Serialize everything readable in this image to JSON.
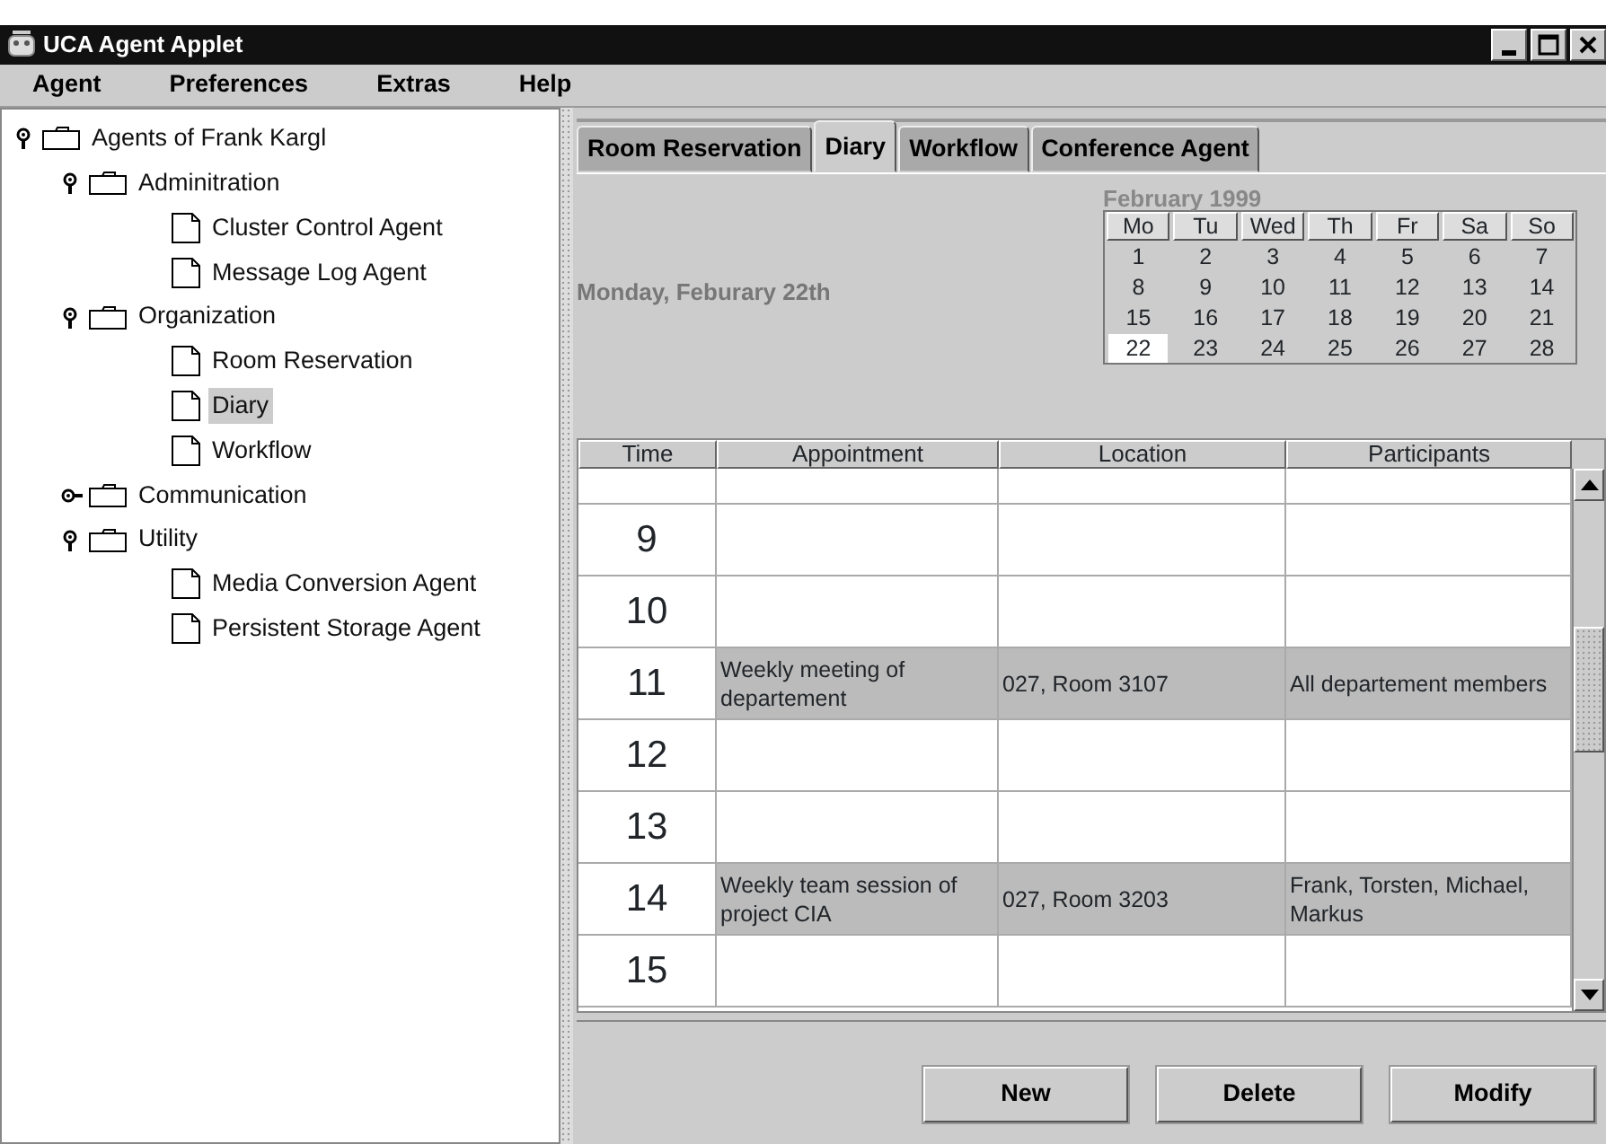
{
  "window": {
    "title": "UCA Agent Applet"
  },
  "menu": [
    "Agent",
    "Preferences",
    "Extras",
    "Help"
  ],
  "tree": {
    "kind": "folder",
    "label": "Agents of Frank Kargl",
    "expanded": true,
    "selected": false,
    "children": [
      {
        "kind": "folder",
        "label": "Adminitration",
        "expanded": true,
        "selected": false,
        "children": [
          {
            "kind": "leaf",
            "label": "Cluster Control Agent",
            "selected": false
          },
          {
            "kind": "leaf",
            "label": "Message Log Agent",
            "selected": false
          }
        ]
      },
      {
        "kind": "folder",
        "label": "Organization",
        "expanded": true,
        "selected": false,
        "children": [
          {
            "kind": "leaf",
            "label": "Room Reservation",
            "selected": false
          },
          {
            "kind": "leaf",
            "label": "Diary",
            "selected": true
          },
          {
            "kind": "leaf",
            "label": "Workflow",
            "selected": false
          }
        ]
      },
      {
        "kind": "folder",
        "label": "Communication",
        "expanded": false,
        "selected": false
      },
      {
        "kind": "folder",
        "label": "Utility",
        "expanded": true,
        "selected": false,
        "children": [
          {
            "kind": "leaf",
            "label": "Media Conversion Agent",
            "selected": false
          },
          {
            "kind": "leaf",
            "label": "Persistent Storage Agent",
            "selected": false
          }
        ]
      }
    ]
  },
  "tabs": [
    {
      "label": "Room Reservation",
      "selected": false
    },
    {
      "label": "Diary",
      "selected": true
    },
    {
      "label": "Workflow",
      "selected": false
    },
    {
      "label": "Conference Agent",
      "selected": false
    }
  ],
  "date_label": "Monday, Feburary 22th",
  "calendar": {
    "month": "February 1999",
    "weekdays": [
      "Mo",
      "Tu",
      "Wed",
      "Th",
      "Fr",
      "Sa",
      "So"
    ],
    "days": [
      {
        "label": "1",
        "selected": false
      },
      {
        "label": "2",
        "selected": false
      },
      {
        "label": "3",
        "selected": false
      },
      {
        "label": "4",
        "selected": false
      },
      {
        "label": "5",
        "selected": false
      },
      {
        "label": "6",
        "selected": false
      },
      {
        "label": "7",
        "selected": false
      },
      {
        "label": "8",
        "selected": false
      },
      {
        "label": "9",
        "selected": false
      },
      {
        "label": "10",
        "selected": false
      },
      {
        "label": "11",
        "selected": false
      },
      {
        "label": "12",
        "selected": false
      },
      {
        "label": "13",
        "selected": false
      },
      {
        "label": "14",
        "selected": false
      },
      {
        "label": "15",
        "selected": false
      },
      {
        "label": "16",
        "selected": false
      },
      {
        "label": "17",
        "selected": false
      },
      {
        "label": "18",
        "selected": false
      },
      {
        "label": "19",
        "selected": false
      },
      {
        "label": "20",
        "selected": false
      },
      {
        "label": "21",
        "selected": false
      },
      {
        "label": "22",
        "selected": true
      },
      {
        "label": "23",
        "selected": false
      },
      {
        "label": "24",
        "selected": false
      },
      {
        "label": "25",
        "selected": false
      },
      {
        "label": "26",
        "selected": false
      },
      {
        "label": "27",
        "selected": false
      },
      {
        "label": "28",
        "selected": false
      }
    ]
  },
  "table": {
    "columns": [
      "Time",
      "Appointment",
      "Location",
      "Participants"
    ],
    "rows": [
      {
        "time": "9",
        "booked": false
      },
      {
        "time": "10",
        "booked": false
      },
      {
        "time": "11",
        "appointment": "Weekly meeting of departement",
        "location": "027, Room 3107",
        "participants": "All departement members",
        "booked": true
      },
      {
        "time": "12",
        "booked": false
      },
      {
        "time": "13",
        "booked": false
      },
      {
        "time": "14",
        "appointment": "Weekly team session of project CIA",
        "location": "027, Room 3203",
        "participants": "Frank, Torsten, Michael, Markus",
        "booked": true
      },
      {
        "time": "15",
        "booked": false
      }
    ]
  },
  "buttons": [
    "New",
    "Delete",
    "Modify"
  ]
}
